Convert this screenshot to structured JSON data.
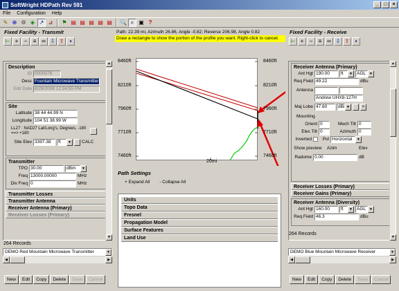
{
  "window": {
    "title": "SoftWright HDPath Rev 591",
    "min": "_",
    "max": "□",
    "close": "×"
  },
  "menu": [
    "File",
    "Configuration",
    "Help"
  ],
  "toolbar_icons": [
    "pencil-icon",
    "target-icon",
    "wrench-icon",
    "nodes-icon",
    "arrow-icon",
    "ruler-icon",
    "flag-icon",
    "chart-icon",
    "chart-icon",
    "chart-icon",
    "chart-icon",
    "chart-icon",
    "zoom-icon",
    "zoom-rect-icon",
    "print-icon",
    "help-icon"
  ],
  "path_info": "Path: 22.39 mi, Azimuth 26.86, Angle -0.82; Reverse 206.98, Angle 0.82",
  "instruction": "Draw a rectangle to show the portion of the profile you want. Right-click to cancel.",
  "left": {
    "heading": "Fixed Facility - Transmit",
    "description": {
      "title": "Description",
      "id_label": "ID",
      "id_value": "0000076",
      "desc_label": "Desc",
      "desc_value": "Fountain Microwave Transmitter",
      "edit_label": "Edit Date",
      "edit_value": "8/28/2008 12:24:55 PM"
    },
    "site": {
      "title": "Site",
      "lat_label": "Latitude",
      "lat_value": "38 44 44.99 N",
      "lon_label": "Longitude",
      "lon_value": "104 51 38.99 W",
      "datum_text": "LL27 : NAD27 Lat/Long's, Degrees, -180 ==> +180",
      "elev_label": "Site Elev",
      "elev_value": "3397.38",
      "elev_unit": "ft",
      "calc": "CALC"
    },
    "transmitter": {
      "title": "Transmitter",
      "tpo_label": "TPO",
      "tpo_value": "30.00",
      "tpo_unit": "dBm",
      "freq_label": "Freq",
      "freq_value": "13000.00000",
      "freq_unit": "MHz",
      "div_label": "Div Freq",
      "div_value": "0",
      "div_unit": "MHz"
    },
    "sections": [
      "Transmitter Losses",
      "Transmitter Antenna",
      "Receiver Antenna (Primary)",
      "Receiver Losses (Primary)"
    ],
    "records": "264 Records",
    "selected": "DEMO Red Mountain Microwave Transmitter",
    "buttons": [
      "New",
      "Edit",
      "Copy",
      "Delete",
      "Save",
      "Cancel"
    ]
  },
  "right": {
    "heading": "Fixed Facility - Receive",
    "primary": {
      "title": "Receiver Antenna (Primary)",
      "hgt_label": "Ant Hgt",
      "hgt_value": "190.00",
      "hgt_unit": "ft",
      "hgt_ref": "AGL",
      "req_label": "Req Field",
      "req_value": "49.22",
      "req_unit": "dBu",
      "ant_label": "Antenna",
      "ant_value": "Andrew UHX8-127H",
      "maj_label": "Maj Lobe",
      "maj_value": "47.60",
      "maj_unit": "dBi",
      "mounting": "Mounting",
      "orient_label": "Orient",
      "orient_value": "0",
      "mech_label": "Mech Tilt",
      "mech_value": "0",
      "elec_label": "Elec Tilt",
      "elec_value": "0",
      "azim_label": "Azimuth",
      "azim_value": "0",
      "inv_label": "Inverted",
      "pol_label": "Pol",
      "pol_value": "Horizontal",
      "preview": "Show preview",
      "azim_col": "Azim",
      "elev_col": "Elev",
      "radome_label": "Radome",
      "radome_value": "0.00",
      "radome_unit": "dB"
    },
    "sections": [
      "Receiver Losses (Primary)",
      "Receiver Gains (Primary)"
    ],
    "diversity": {
      "title": "Receiver Antenna (Diversity)",
      "hgt_label": "Ant Hgt",
      "hgt_value": "160.00",
      "hgt_unit": "ft",
      "hgt_ref": "AGL",
      "req_label": "Req Field",
      "req_value": "46.3",
      "req_unit": "dBu"
    },
    "records": "264 Records",
    "selected": "DEMO Blue Mountain Microwave Receiver",
    "buttons": [
      "New",
      "Edit",
      "Copy",
      "Delete",
      "Save",
      "Cancel"
    ]
  },
  "profile": {
    "y_labels_left": [
      "8460ft",
      "8210ft",
      "7960ft",
      "7710ft",
      "7460ft"
    ],
    "y_labels_right": [
      "8460ft",
      "8210ft",
      "7960ft",
      "7710ft",
      "7460ft"
    ],
    "x_label": "20mi"
  },
  "path_settings": {
    "title": "Path Settings",
    "expand": "+ Expand All",
    "collapse": "- Collapse All",
    "items": [
      "Units",
      "Topo Data",
      "Fresnel",
      "Propagation Model",
      "Surface Features",
      "Land Use"
    ]
  },
  "colors": {
    "title_start": "#0a246a",
    "title_end": "#a6caf0",
    "instruction_bg": "#ffff00",
    "annotation_arrow": "#e00000",
    "terrain": "#00cc00"
  }
}
